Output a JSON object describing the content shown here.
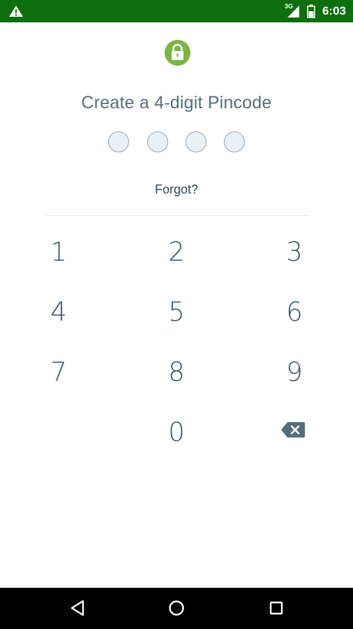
{
  "status_bar": {
    "time": "6:03",
    "network": "3G",
    "warning_icon": "warning-icon",
    "signal_icon": "signal-icon",
    "battery_icon": "battery-icon",
    "background_color": "#0d6e0d"
  },
  "header": {
    "lock_icon": "lock-icon",
    "lock_color": "#7cb342"
  },
  "pin": {
    "title": "Create a 4-digit Pincode",
    "digits_entered": 0,
    "digit_count": 4
  },
  "forgot_label": "Forgot?",
  "keypad": {
    "keys": [
      "1",
      "2",
      "3",
      "4",
      "5",
      "6",
      "7",
      "8",
      "9",
      "0"
    ],
    "backspace_icon": "backspace-icon"
  },
  "nav_bar": {
    "back_icon": "back-triangle-icon",
    "home_icon": "home-circle-icon",
    "recents_icon": "recents-square-icon"
  }
}
